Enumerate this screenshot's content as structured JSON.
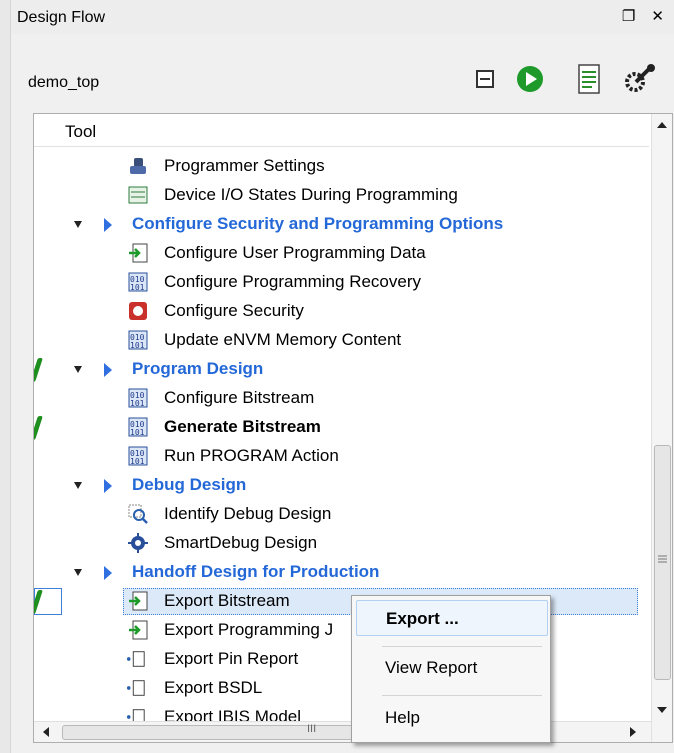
{
  "panel": {
    "title": "Design Flow",
    "title_buttons": "❐ ✕",
    "project": "demo_top",
    "toolbar": [
      "collapse-all-icon",
      "run-icon",
      "report-icon",
      "options-wrench-icon"
    ]
  },
  "tree": {
    "header": "Tool",
    "rows": [
      {
        "label": "Programmer Settings",
        "icon": "programmer-icon"
      },
      {
        "label": "Device I/O States During Programming",
        "icon": "io-states-icon"
      },
      {
        "label": "Configure Security and Programming Options",
        "section": true
      },
      {
        "label": "Configure User Programming Data",
        "icon": "user-data-icon"
      },
      {
        "label": "Configure Programming Recovery",
        "icon": "bitstream-icon"
      },
      {
        "label": "Configure Security",
        "icon": "security-icon"
      },
      {
        "label": "Update eNVM Memory Content",
        "icon": "bitstream-icon"
      },
      {
        "label": "Program Design",
        "section": true
      },
      {
        "label": "Configure Bitstream",
        "icon": "bitstream-icon"
      },
      {
        "label": "Generate Bitstream",
        "icon": "bitstream-icon"
      },
      {
        "label": "Run PROGRAM Action",
        "icon": "bitstream-icon"
      },
      {
        "label": "Debug Design",
        "section": true
      },
      {
        "label": "Identify Debug Design",
        "icon": "identify-icon"
      },
      {
        "label": "SmartDebug Design",
        "icon": "smartdebug-icon"
      },
      {
        "label": "Handoff Design for Production",
        "section": true
      },
      {
        "label": "Export Bitstream",
        "icon": "export-icon"
      },
      {
        "label": "Export Programming J",
        "icon": "export-icon"
      },
      {
        "label": "Export Pin Report",
        "icon": "file-icon"
      },
      {
        "label": "Export BSDL",
        "icon": "file-icon"
      },
      {
        "label": "Export IBIS Model",
        "icon": "file-icon"
      }
    ],
    "hscroll_mark": "III"
  },
  "context_menu": {
    "items": [
      "Export ...",
      "View Report",
      "Help"
    ]
  },
  "colors": {
    "section": "#2468d8",
    "status_ok": "#1e8f1e",
    "selection": "#dbe9f8"
  }
}
